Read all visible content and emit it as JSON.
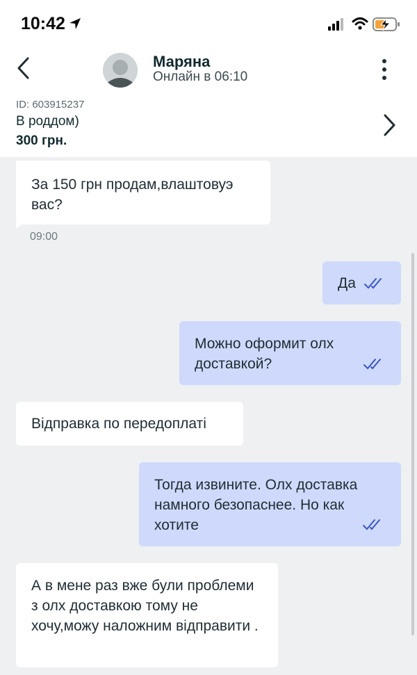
{
  "status_bar": {
    "time": "10:42",
    "icons": [
      "location-arrow-icon",
      "signal-icon",
      "wifi-icon",
      "battery-charging-icon"
    ]
  },
  "header": {
    "contact_name": "Маряна",
    "presence": "Онлайн в 06:10"
  },
  "ad": {
    "id": "ID: 603915237",
    "title": "В роддом)",
    "price": "300 грн."
  },
  "messages": [
    {
      "direction": "incoming",
      "text": "За 150 грн продам,влаштовуэ вас?",
      "time": "09:00"
    },
    {
      "direction": "outgoing",
      "text": "Да",
      "status": "read"
    },
    {
      "direction": "outgoing",
      "text": "Можно оформит олх доставкой?",
      "status": "read"
    },
    {
      "direction": "incoming",
      "text": "Відправка по передоплаті"
    },
    {
      "direction": "outgoing",
      "text": "Тогда извините. Олх доставка намного безопаснее. Но как хотите",
      "status": "read"
    },
    {
      "direction": "incoming",
      "text": "А в мене раз вже були проблеми з олх доставкою тому не хочу,можу наложним відправити ."
    }
  ],
  "colors": {
    "outgoing_bubble": "#cfd9fb",
    "incoming_bubble": "#ffffff",
    "chat_background": "#eef0f2",
    "read_ticks": "#3a57c4"
  }
}
